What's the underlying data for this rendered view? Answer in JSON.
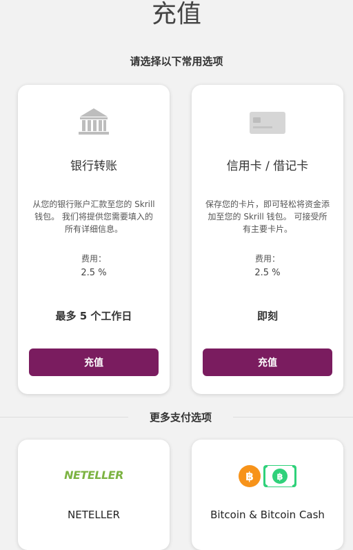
{
  "page": {
    "title": "充值",
    "section_heading": "请选择以下常用选项",
    "more_heading": "更多支付选项"
  },
  "cards": [
    {
      "icon": "bank-icon",
      "title": "银行转账",
      "description": "从您的银行账户汇款至您的 Skrill 钱包。 我们将提供您需要填入的所有详细信息。",
      "fee_label": "费用：",
      "fee_value": "2.5 %",
      "timing": "最多 5 个工作日",
      "button": "充值"
    },
    {
      "icon": "credit-card-icon",
      "title": "信用卡 / 借记卡",
      "description": "保存您的卡片，即可轻松将资金添加至您的 Skrill 钱包。 可接受所有主要卡片。",
      "fee_label": "费用：",
      "fee_value": "2.5 %",
      "timing": "即刻",
      "button": "充值"
    }
  ],
  "more_options": [
    {
      "logo": "NETELLER",
      "title": "NETELLER"
    },
    {
      "logo": "bitcoin-icon",
      "title": "Bitcoin & Bitcoin Cash"
    }
  ],
  "colors": {
    "accent": "#7a1c5f",
    "background": "#f2f2f2",
    "neteller_green": "#7cb342",
    "bitcoin_orange": "#f7931a",
    "bitcoin_cash_green": "#2fd17a"
  }
}
